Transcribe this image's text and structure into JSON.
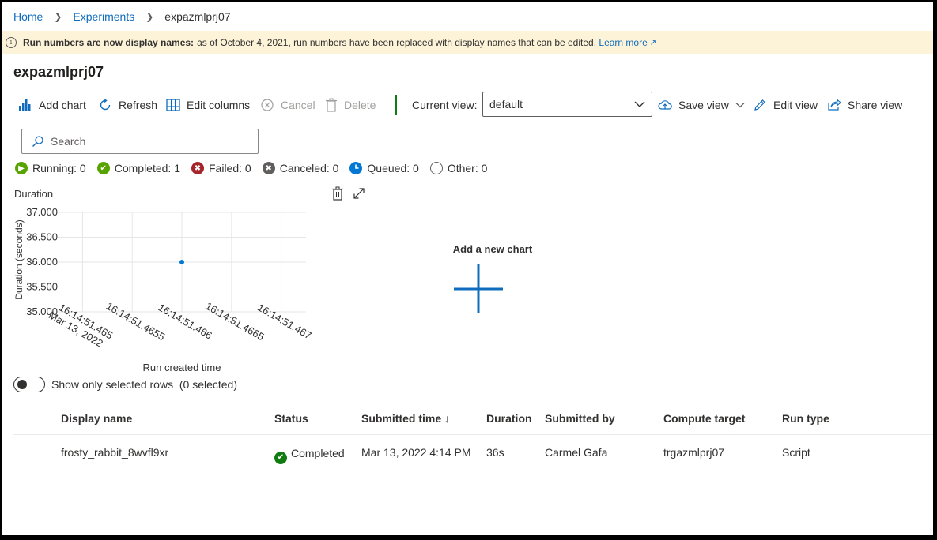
{
  "breadcrumb": [
    {
      "label": "Home"
    },
    {
      "label": "Experiments"
    },
    {
      "label": "expazmlprj07"
    }
  ],
  "banner": {
    "bold": "Run numbers are now display names:",
    "text": "as of October 4, 2021, run numbers have been replaced with display names that can be edited.",
    "link": "Learn more"
  },
  "page_title": "expazmlprj07",
  "toolbar": {
    "add_chart": "Add chart",
    "refresh": "Refresh",
    "edit_columns": "Edit columns",
    "cancel": "Cancel",
    "delete": "Delete",
    "current_view_label": "Current view:",
    "current_view_value": "default",
    "save_view": "Save view",
    "edit_view": "Edit view",
    "share_view": "Share view"
  },
  "search": {
    "placeholder": "Search"
  },
  "status_filters": [
    {
      "label": "Running: 0",
      "color": "#57a300"
    },
    {
      "label": "Completed: 1",
      "color": "#57a300"
    },
    {
      "label": "Failed: 0",
      "color": "#a4262c"
    },
    {
      "label": "Canceled: 0",
      "color": "#605e5c"
    },
    {
      "label": "Queued: 0",
      "color": "#0078d4"
    },
    {
      "label": "Other: 0",
      "color": "#ffffff"
    }
  ],
  "chart_data": {
    "type": "scatter",
    "title": "Duration",
    "xlabel": "Run created time",
    "ylabel": "Duration (seconds)",
    "yticks": [
      "37.000",
      "36.500",
      "36.000",
      "35.500",
      "35.000"
    ],
    "ylim": [
      35,
      37
    ],
    "xticks": [
      "16:14:51.465",
      "16:14:51.4655",
      "16:14:51.466",
      "16:14:51.4665",
      "16:14:51.467"
    ],
    "xtick_sub": "Mar 13, 2022",
    "points": [
      {
        "x": "16:14:51.466",
        "y": 36
      }
    ],
    "point_color": "#0078d4",
    "grid": true
  },
  "new_chart": {
    "label": "Add a new chart"
  },
  "toggle": {
    "label": "Show only selected rows",
    "count": "(0 selected)"
  },
  "table": {
    "headers": {
      "display_name": "Display name",
      "status": "Status",
      "submitted_time": "Submitted time ↓",
      "duration": "Duration",
      "submitted_by": "Submitted by",
      "compute_target": "Compute target",
      "run_type": "Run type"
    },
    "rows": [
      {
        "display_name": "frosty_rabbit_8wvfl9xr",
        "status": "Completed",
        "submitted_time": "Mar 13, 2022 4:14 PM",
        "duration": "36s",
        "submitted_by": "Carmel Gafa",
        "compute_target": "trgazmlprj07",
        "run_type": "Script"
      }
    ]
  }
}
